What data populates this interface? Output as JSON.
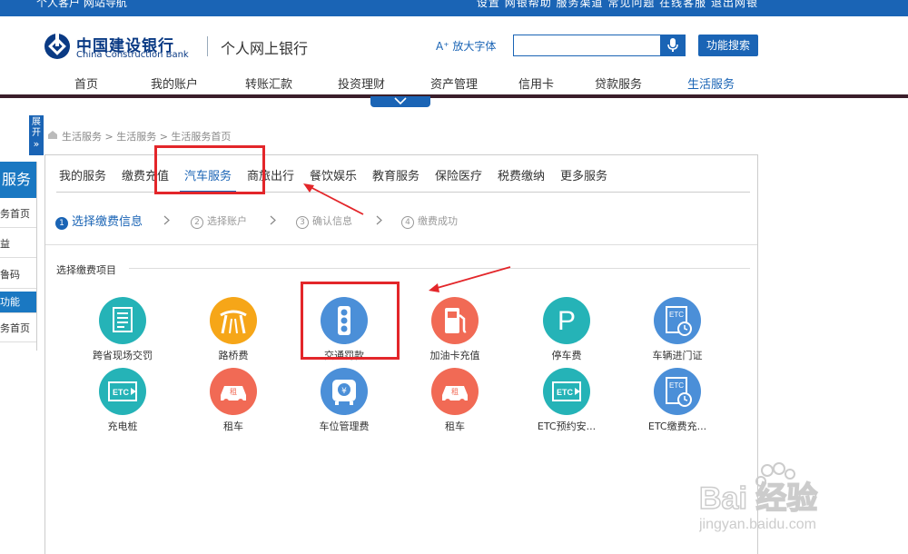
{
  "topbar": {
    "left_text": "个人客户   网站导航",
    "right_text": "设置   网银帮助   服务渠道   常见问题   在线客服   退出网银"
  },
  "header": {
    "bank_name_cn": "中国建设银行",
    "bank_name_en": "China Construction Bank",
    "site_name": "个人网上银行",
    "font_button": "A⁺ 放大字体",
    "search_placeholder": "",
    "search_button": "功能搜索"
  },
  "nav": {
    "items": [
      {
        "label": "首页",
        "active": false
      },
      {
        "label": "我的账户",
        "active": false
      },
      {
        "label": "转账汇款",
        "active": false
      },
      {
        "label": "投资理财",
        "active": false
      },
      {
        "label": "资产管理",
        "active": false
      },
      {
        "label": "信用卡",
        "active": false
      },
      {
        "label": "贷款服务",
        "active": false
      },
      {
        "label": "生活服务",
        "active": true
      }
    ]
  },
  "sidebar": {
    "expand_label": "展开",
    "head": "服务",
    "items": [
      {
        "label": "务首页",
        "highlight": false
      },
      {
        "label": "益",
        "highlight": false
      },
      {
        "label": "鲁码",
        "highlight": false
      },
      {
        "label": "功能",
        "highlight": true
      },
      {
        "label": "务首页",
        "highlight": false
      }
    ]
  },
  "breadcrumb": "生活服务 > 生活服务 > 生活服务首页",
  "tabs": [
    {
      "label": "我的服务",
      "active": false
    },
    {
      "label": "缴费充值",
      "active": false
    },
    {
      "label": "汽车服务",
      "active": true
    },
    {
      "label": "商旅出行",
      "active": false
    },
    {
      "label": "餐饮娱乐",
      "active": false
    },
    {
      "label": "教育服务",
      "active": false
    },
    {
      "label": "保险医疗",
      "active": false
    },
    {
      "label": "税费缴纳",
      "active": false
    },
    {
      "label": "更多服务",
      "active": false
    }
  ],
  "steps": [
    {
      "num": "1",
      "label": "选择缴费信息",
      "active": true
    },
    {
      "num": "2",
      "label": "选择账户",
      "active": false
    },
    {
      "num": "3",
      "label": "确认信息",
      "active": false
    },
    {
      "num": "4",
      "label": "缴费成功",
      "active": false
    }
  ],
  "section_label": "选择缴费项目",
  "services": [
    {
      "label": "跨省现场交罚",
      "icon": "document-icon",
      "color": "#25b3b7"
    },
    {
      "label": "路桥费",
      "icon": "road-bridge-icon",
      "color": "#f6a618"
    },
    {
      "label": "交通罚款",
      "icon": "traffic-light-icon",
      "color": "#4b8fd8"
    },
    {
      "label": "加油卡充值",
      "icon": "fuel-pump-icon",
      "color": "#f16a55"
    },
    {
      "label": "停车费",
      "icon": "parking-icon",
      "color": "#25b3b7"
    },
    {
      "label": "车辆进门证",
      "icon": "etc-clock-icon",
      "color": "#4b8fd8"
    },
    {
      "label": "充电桩",
      "icon": "etc-card-icon",
      "color": "#25b3b7"
    },
    {
      "label": "租车",
      "icon": "rental-car-icon",
      "color": "#f16a55"
    },
    {
      "label": "车位管理费",
      "icon": "yuan-bus-icon",
      "color": "#4b8fd8"
    },
    {
      "label": "租车",
      "icon": "rental-car-icon",
      "color": "#f16a55"
    },
    {
      "label": "ETC预约安...",
      "icon": "etc-card-icon",
      "color": "#25b3b7"
    },
    {
      "label": "ETC缴费充...",
      "icon": "etc-clock-icon",
      "color": "#4b8fd8"
    }
  ],
  "watermark": {
    "logo": "Bai 经验",
    "url": "jingyan.baidu.com"
  }
}
